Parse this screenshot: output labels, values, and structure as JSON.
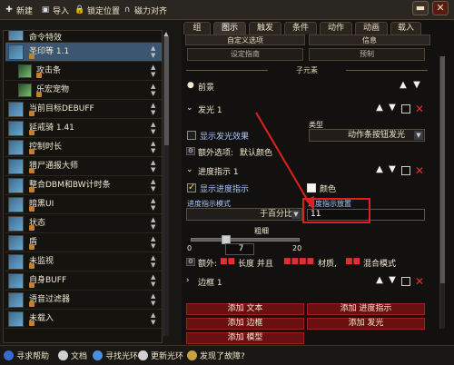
{
  "topbar": {
    "new": "新建",
    "import": "导入",
    "lock": "锁定位置",
    "magnet": "磁力对齐",
    "close_glyph": "✕",
    "min_glyph": "▬"
  },
  "aura_list": [
    {
      "name": "命令特效",
      "child": false,
      "sel": false
    },
    {
      "name": "圣印等 1.1",
      "child": false,
      "sel": true
    },
    {
      "name": "攻击条",
      "child": true,
      "sel": false
    },
    {
      "name": "乐宏宠物",
      "child": true,
      "sel": false
    },
    {
      "name": "当前目标DEBUFF",
      "child": false,
      "sel": false
    },
    {
      "name": "延戒骑 1.41",
      "child": false,
      "sel": false
    },
    {
      "name": "控制时长",
      "child": false,
      "sel": false
    },
    {
      "name": "猎尸通报大师",
      "child": false,
      "sel": false
    },
    {
      "name": "整合DBM和BW计时条",
      "child": false,
      "sel": false
    },
    {
      "name": "暗黑UI",
      "child": false,
      "sel": false
    },
    {
      "name": "状态",
      "child": false,
      "sel": false
    },
    {
      "name": "盾",
      "child": false,
      "sel": false
    },
    {
      "name": "未监视",
      "child": false,
      "sel": false
    },
    {
      "name": "自身BUFF",
      "child": false,
      "sel": false
    },
    {
      "name": "语音过滤器",
      "child": false,
      "sel": false
    },
    {
      "name": "未载入",
      "child": false,
      "sel": false
    }
  ],
  "left_top_partial": "命令特效",
  "bottombar": {
    "help": "寻求帮助",
    "docs": "文档",
    "halo": "寻找光环",
    "updates": "更新光环",
    "bug": "发现了故障?"
  },
  "tabs": [
    "组",
    "图示",
    "触发",
    "条件",
    "动作",
    "动画",
    "载入"
  ],
  "subtabs": [
    "自定义选项",
    "信息"
  ],
  "top_dropdowns": {
    "left": "设定指南",
    "right": "预制"
  },
  "section_subelements": "子元素",
  "background_label": "前景",
  "glow": {
    "label": "发光 1",
    "type_label": "类型",
    "show_glow_label": "显示发光效果",
    "type_value": "动作条按钮发光",
    "extra_label": "额外选项:",
    "extra_value": "默认颜色"
  },
  "progress": {
    "label": "进度指示 1",
    "show_label": "显示进度指示",
    "color_label": "颜色",
    "mode_label": "进度指示模式",
    "mode_value": "于百分比",
    "placement_label": "进度指示放置",
    "placement_value": "11",
    "width_label": "粗细",
    "slider_min": "0",
    "slider_value": "7",
    "slider_max": "20",
    "extra_prefix": "额外:",
    "extra_text_a": "长度 并且",
    "extra_text_b": "材质,",
    "extra_text_c": "混合模式"
  },
  "border": {
    "label": "边框 1"
  },
  "actions": {
    "add_text": "添加 文本",
    "add_progress": "添加 进度指示",
    "add_border": "添加 边框",
    "add_glow": "添加 发光",
    "add_model": "添加 模型"
  },
  "colors": {
    "accent_red": "#e02020",
    "button_red": "#6a1010",
    "selected": "#3c5570"
  }
}
